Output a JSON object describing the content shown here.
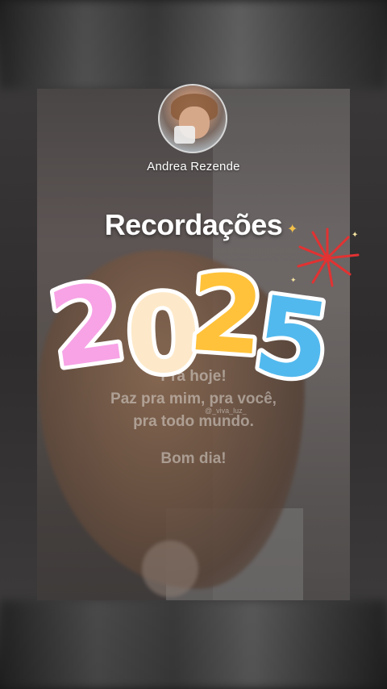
{
  "author": {
    "name": "Andrea Rezende",
    "avatar_icon": "profile-photo"
  },
  "sticker": {
    "title": "Recordações",
    "year": "2025",
    "digits": [
      "2",
      "0",
      "2",
      "5"
    ],
    "digit_colors": [
      "#f7a3e6",
      "#fde9c9",
      "#ffc23a",
      "#52b9ee"
    ],
    "firework_color": "#e23232"
  },
  "photo_text": {
    "line1": "Pra hoje!",
    "line2": "Paz pra mim, pra você,",
    "line3": "pra todo mundo.",
    "line4": "Bom dia!",
    "watermark": "@_viva_luz_"
  }
}
